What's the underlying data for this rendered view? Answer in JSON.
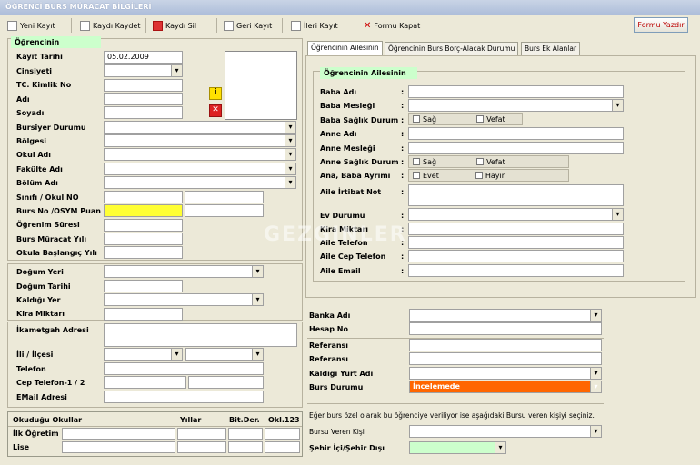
{
  "window": {
    "title": "ÖĞRENCİ BURS MÜRACAT BİLGİLERİ"
  },
  "toolbar": {
    "new": "Yeni Kayıt",
    "save": "Kaydı Kaydet",
    "delete": "Kaydı Sil",
    "back": "Geri Kayıt",
    "forward": "İleri Kayıt",
    "close": "Formu Kapat",
    "print": "Formu Yazdır"
  },
  "student": {
    "group": "Öğrencinin",
    "labels": {
      "kayit_tarihi": "Kayıt Tarihi",
      "cinsiyet": "Cinsiyeti",
      "tc": "TC. Kimlik No",
      "adi": "Adı",
      "soyadi": "Soyadı",
      "bursiyer": "Bursiyer Durumu",
      "bolgesi": "Bölgesi",
      "okul": "Okul Adı",
      "fakulte": "Fakülte Adı",
      "bolum": "Bölüm Adı",
      "sinif": "Sınıfı / Okul NO",
      "burs_no": "Burs No /OSYM Puan",
      "ogrenim": "Öğrenim Süresi",
      "muracat": "Burs Müracat Yılı",
      "baslangic": "Okula Başlangıç Yılı",
      "dogum_yeri": "Doğum Yeri",
      "dogum_tarihi": "Doğum Tarihi",
      "kaldigi": "Kaldığı Yer",
      "kira": "Kira Miktarı",
      "ikamet": "İkametgah Adresi",
      "il": "İli / İlçesi",
      "telefon": "Telefon",
      "cep": "Cep Telefon-1  / 2",
      "email": "EMail Adresi"
    },
    "values": {
      "kayit_tarihi": "05.02.2009"
    }
  },
  "schools": {
    "headers": [
      "Okuduğu Okullar",
      "Yıllar",
      "Bit.Der.",
      "Okl.123"
    ],
    "rows": [
      "İlk Öğretim",
      "Lise"
    ]
  },
  "tabs": [
    "Öğrencinin Ailesinin",
    "Öğrencinin Burs Borç-Alacak Durumu",
    "Burs Ek Alanlar"
  ],
  "family": {
    "group": "Öğrencinin Ailesinin",
    "labels": {
      "baba_adi": "Baba Adı",
      "baba_meslek": "Baba Mesleği",
      "baba_saglik": "Baba Sağlık Durum",
      "anne_adi": "Anne Adı",
      "anne_meslek": "Anne Mesleği",
      "anne_saglik": "Anne Sağlık Durum",
      "ayrimi": "Ana, Baba Ayrımı",
      "irtibat": "Aile İrtibat Not",
      "ev": "Ev Durumu",
      "kira": "Kira Miktarı",
      "telefon": "Aile Telefon",
      "cep": "Aile Cep Telefon",
      "email": "Aile Email"
    },
    "colon": ":",
    "opts": {
      "sag": "Sağ",
      "vefat": "Vefat",
      "evet": "Evet",
      "hayir": "Hayır"
    }
  },
  "bank": {
    "labels": {
      "banka": "Banka Adı",
      "hesap": "Hesap No",
      "ref1": "Referansı",
      "ref2": "Referansı",
      "yurt": "Kaldığı Yurt Adı",
      "durum": "Burs Durumu"
    },
    "durum_value": "İncelemede",
    "note": "Eğer burs özel olarak bu öğrenciye veriliyor ise aşağıdaki Bursu veren kişiyi seçiniz.",
    "veren": "Bursu Veren Kişi",
    "sehir": "Şehir İçi/Şehir Dışı"
  },
  "watermark": "GEZGINLER",
  "colors": {
    "accent": "#FF6600",
    "highlight": "#FFFF33",
    "group": "#CCFFCC"
  }
}
